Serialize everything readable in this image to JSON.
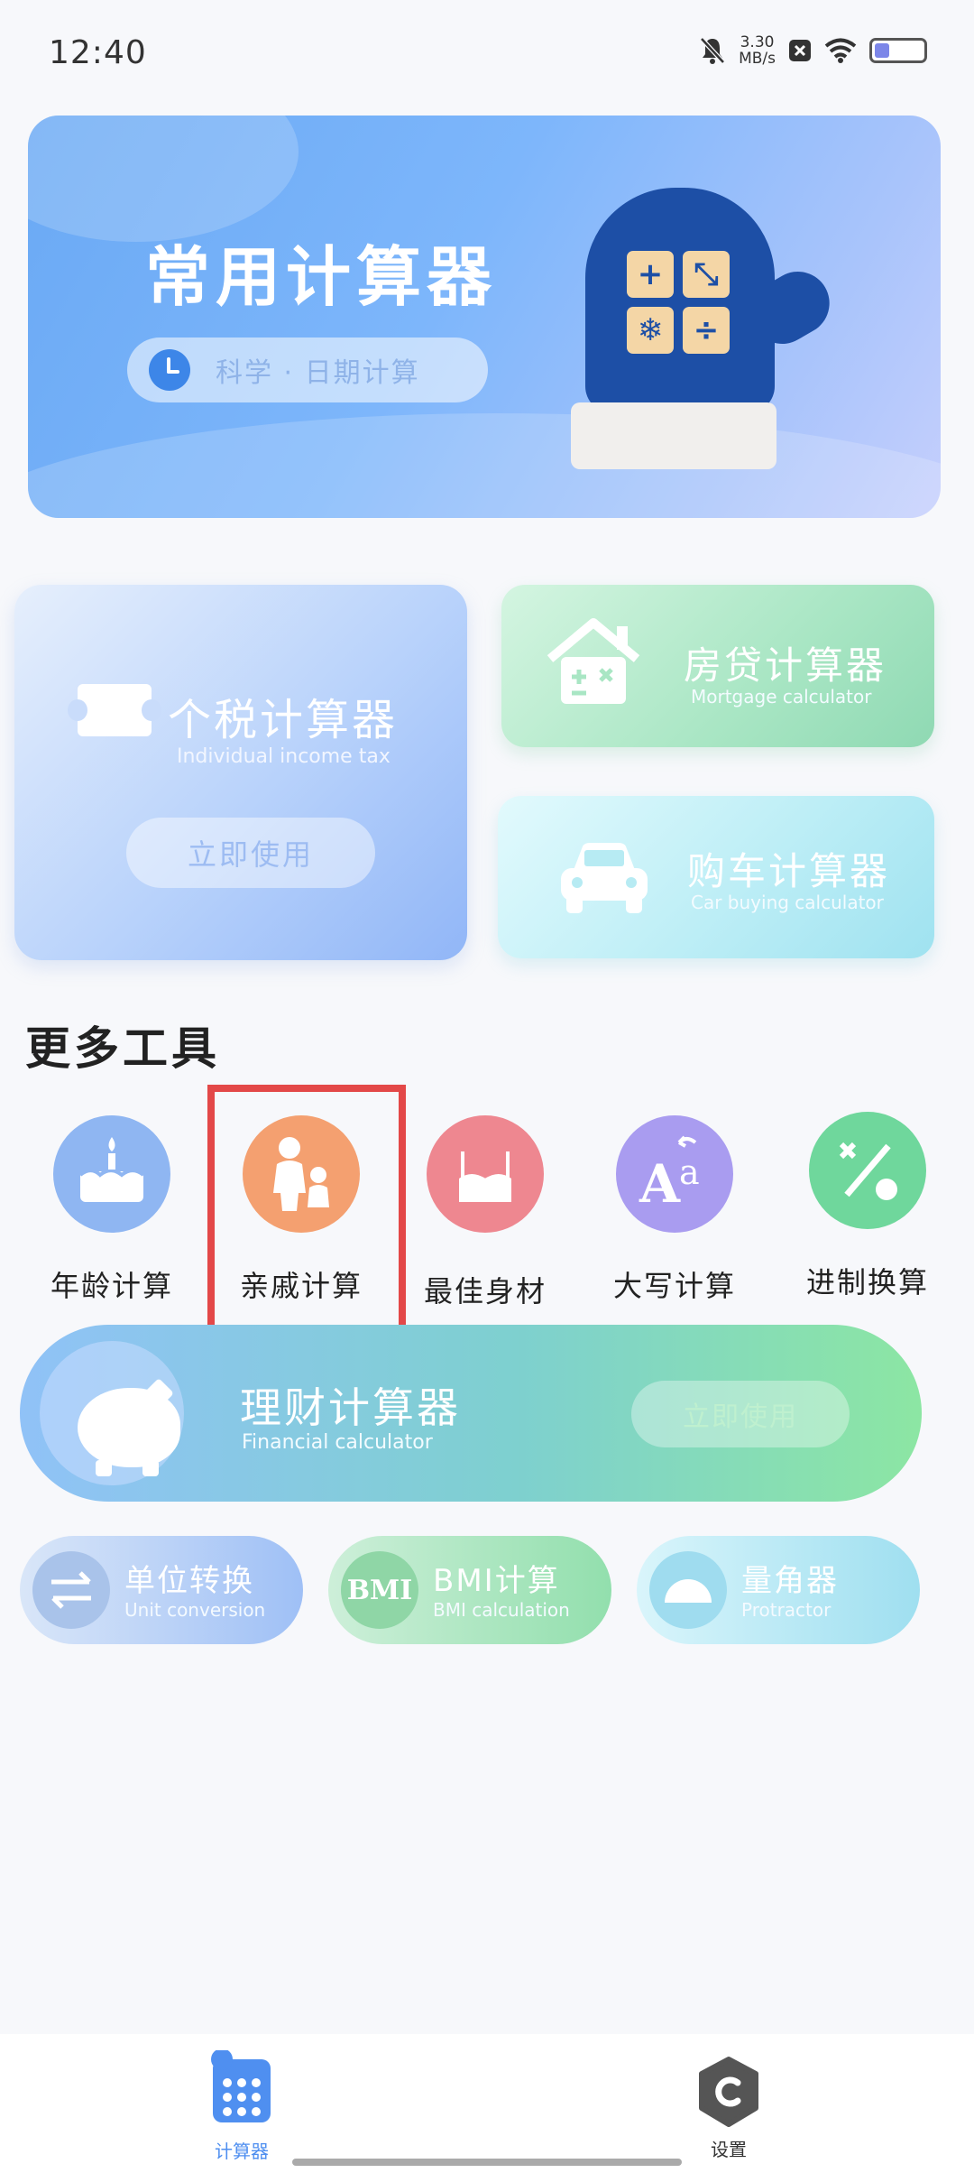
{
  "status_bar": {
    "time": "12:40",
    "net_speed_value": "3.30",
    "net_speed_unit": "MB/s",
    "battery_level": 0.3
  },
  "hero": {
    "title": "常用计算器",
    "subtitle": "科学 · 日期计算",
    "keys": [
      "+",
      "⤡",
      "❄",
      "÷"
    ]
  },
  "tax_card": {
    "title": "个税计算器",
    "subtitle": "Individual income tax",
    "button": "立即使用"
  },
  "mortgage_card": {
    "title": "房贷计算器",
    "subtitle": "Mortgage calculator"
  },
  "car_card": {
    "title": "购车计算器",
    "subtitle": "Car buying calculator"
  },
  "more_tools": {
    "title": "更多工具",
    "items": [
      {
        "label": "年龄计算",
        "color": "#8fb6f2"
      },
      {
        "label": "亲戚计算",
        "color": "#f4a070"
      },
      {
        "label": "最佳身材",
        "color": "#ee8790"
      },
      {
        "label": "大写计算",
        "color": "#a99cf0"
      },
      {
        "label": "进制换算",
        "color": "#6fd79c"
      }
    ]
  },
  "finance_card": {
    "title": "理财计算器",
    "subtitle": "Financial calculator",
    "button": "立即使用"
  },
  "small_tools": [
    {
      "title": "单位转换",
      "subtitle": "Unit conversion",
      "icon": "⇄"
    },
    {
      "title": "BMI计算",
      "subtitle": "BMI calculation",
      "icon": "BMI"
    },
    {
      "title": "量角器",
      "subtitle": "Protractor",
      "icon": ""
    }
  ],
  "bottom_nav": {
    "calculator": "计算器",
    "settings": "设置"
  },
  "colors": {
    "accent": "#3d86e8",
    "highlight_border": "#e34848"
  }
}
